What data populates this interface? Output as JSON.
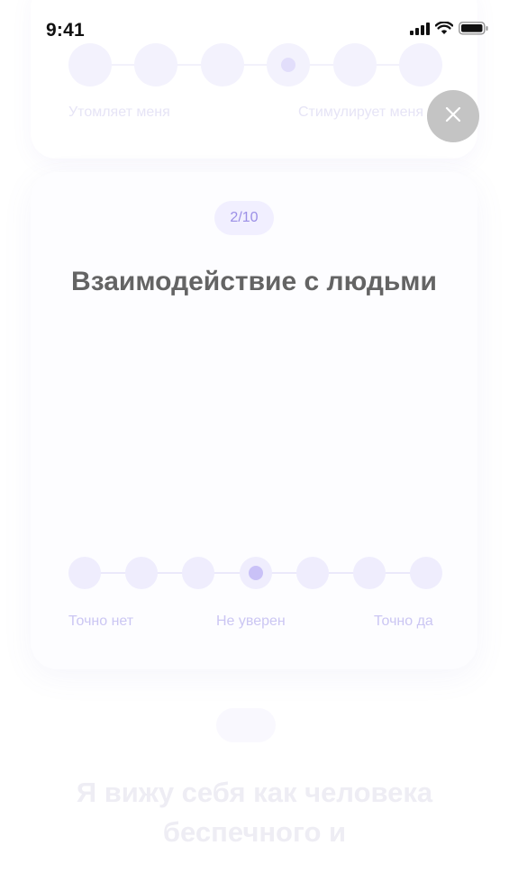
{
  "status_bar": {
    "time": "9:41"
  },
  "prev_card": {
    "left_label": "Утомляет меня",
    "right_label": "Стимулирует меня",
    "selected_index": 3
  },
  "main_card": {
    "counter": "2/10",
    "title": "Взаимодействие с людьми",
    "scale": {
      "count": 7,
      "selected_index": 3,
      "left_label": "Точно нет",
      "middle_label": "Не уверен",
      "right_label": "Точно да"
    }
  },
  "next_card": {
    "title": "Я вижу себя как человека беспечного и"
  },
  "colors": {
    "accent": "#9b8fe6",
    "dot_bg": "#efedfd",
    "selected_dot": "#c9c1f7",
    "title_text": "#646464",
    "close_bg": "#c4c4c4"
  }
}
